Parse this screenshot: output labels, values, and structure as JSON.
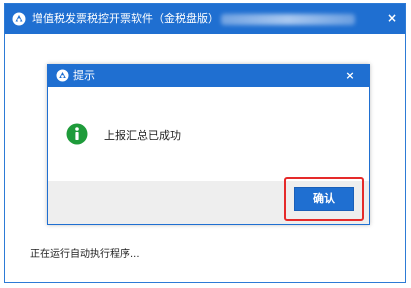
{
  "main_window": {
    "title": "增值税发票税控开票软件（金税盘版）",
    "close_label": "×",
    "status_text": "正在运行自动执行程序..."
  },
  "dialog": {
    "title": "提示",
    "close_label": "×",
    "message": "上报汇总已成功",
    "confirm_label": "确认"
  },
  "icons": {
    "app": "app-logo-icon",
    "info": "info-icon"
  },
  "colors": {
    "titlebar": "#1f6fd1",
    "info_icon": "#1e9b3a",
    "highlight": "#e52a2a",
    "button": "#1f6fd1"
  }
}
